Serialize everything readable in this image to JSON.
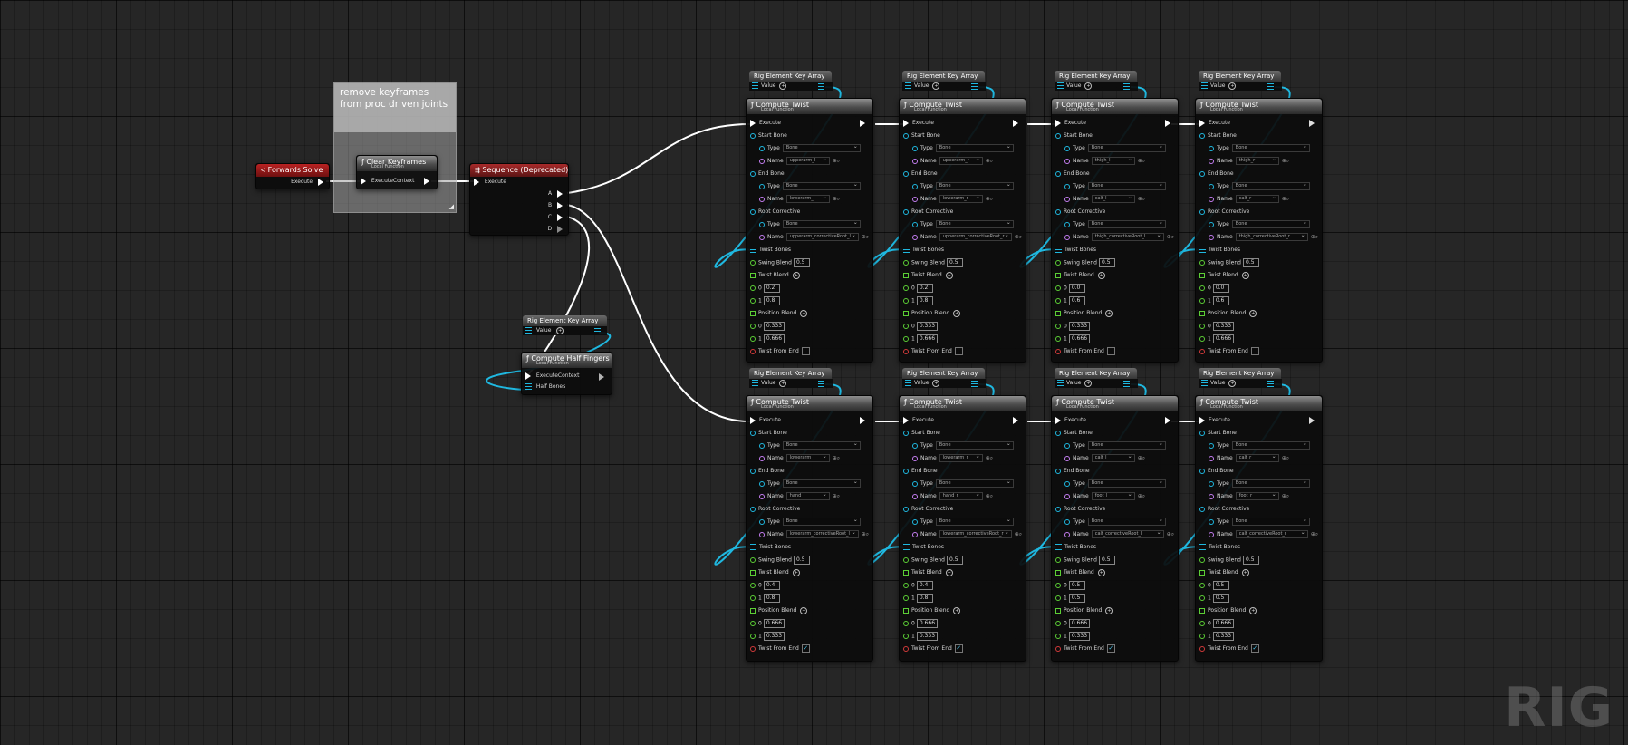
{
  "comment": {
    "text": "remove keyframes from proc driven joints"
  },
  "forwards_solve": {
    "title": "Forwards Solve",
    "pin": "Execute"
  },
  "clear_keyframes": {
    "title": "Clear Keyframes",
    "sub": "Local Function",
    "pin": "ExecuteContext"
  },
  "sequence": {
    "title": "Sequence (Deprecated)",
    "in_pin": "Execute",
    "outs": [
      "A",
      "B",
      "C",
      "D"
    ]
  },
  "half_fingers": {
    "array_title": "Rig Element Key Array",
    "array_value": "Value",
    "title": "Compute Half Fingers",
    "sub": "Local Function",
    "pins": [
      "ExecuteContext",
      "Half Bones"
    ]
  },
  "labels": {
    "array_title": "Rig Element Key Array",
    "value": "Value",
    "title": "Compute Twist",
    "sub": "Local Function",
    "execute": "Execute",
    "start_bone": "Start Bone",
    "end_bone": "End Bone",
    "root_corrective": "Root Corrective",
    "type": "Type",
    "name": "Name",
    "bone": "Bone",
    "twist_bones": "Twist Bones",
    "swing_blend": "Swing Blend",
    "twist_blend": "Twist Blend",
    "position_blend": "Position Blend",
    "twist_from_end": "Twist From End",
    "idx0": "0",
    "idx1": "1"
  },
  "twist_nodes": [
    {
      "start": "upperarm_l",
      "end": "lowerarm_l",
      "root": "upperarm_correctiveRoot_l",
      "swing": "0.5",
      "tb": [
        "0.2",
        "0.8"
      ],
      "pb": [
        "0.333",
        "0.666"
      ],
      "twist_from_end": false
    },
    {
      "start": "upperarm_r",
      "end": "lowerarm_r",
      "root": "upperarm_correctiveRoot_r",
      "swing": "0.5",
      "tb": [
        "0.2",
        "0.8"
      ],
      "pb": [
        "0.333",
        "0.666"
      ],
      "twist_from_end": false
    },
    {
      "start": "thigh_l",
      "end": "calf_l",
      "root": "thigh_correctiveRoot_l",
      "swing": "0.5",
      "tb": [
        "0.0",
        "0.6"
      ],
      "pb": [
        "0.333",
        "0.666"
      ],
      "twist_from_end": false
    },
    {
      "start": "thigh_r",
      "end": "calf_r",
      "root": "thigh_correctiveRoot_r",
      "swing": "0.5",
      "tb": [
        "0.0",
        "0.6"
      ],
      "pb": [
        "0.333",
        "0.666"
      ],
      "twist_from_end": false
    },
    {
      "start": "lowerarm_l",
      "end": "hand_l",
      "root": "lowerarm_correctiveRoot_l",
      "swing": "0.5",
      "tb": [
        "0.4",
        "0.8"
      ],
      "pb": [
        "0.666",
        "0.333"
      ],
      "twist_from_end": true
    },
    {
      "start": "lowerarm_r",
      "end": "hand_r",
      "root": "lowerarm_correctiveRoot_r",
      "swing": "0.5",
      "tb": [
        "0.4",
        "0.8"
      ],
      "pb": [
        "0.666",
        "0.333"
      ],
      "twist_from_end": true
    },
    {
      "start": "calf_l",
      "end": "foot_l",
      "root": "calf_correctiveRoot_l",
      "swing": "0.5",
      "tb": [
        "0.5",
        "0.5"
      ],
      "pb": [
        "0.666",
        "0.333"
      ],
      "twist_from_end": true
    },
    {
      "start": "calf_r",
      "end": "foot_r",
      "root": "calf_correctiveRoot_r",
      "swing": "0.5",
      "tb": [
        "0.5",
        "0.5"
      ],
      "pb": [
        "0.666",
        "0.333"
      ],
      "twist_from_end": true
    }
  ],
  "watermark": "RIG",
  "colors": {
    "exec_wire": "#ffffff",
    "array_wire": "#1fb8e0",
    "struct_pin": "#c57ef2",
    "float_pin": "#5ccf35",
    "bool_pin": "#d23a3a",
    "event_header": "#b92222"
  }
}
